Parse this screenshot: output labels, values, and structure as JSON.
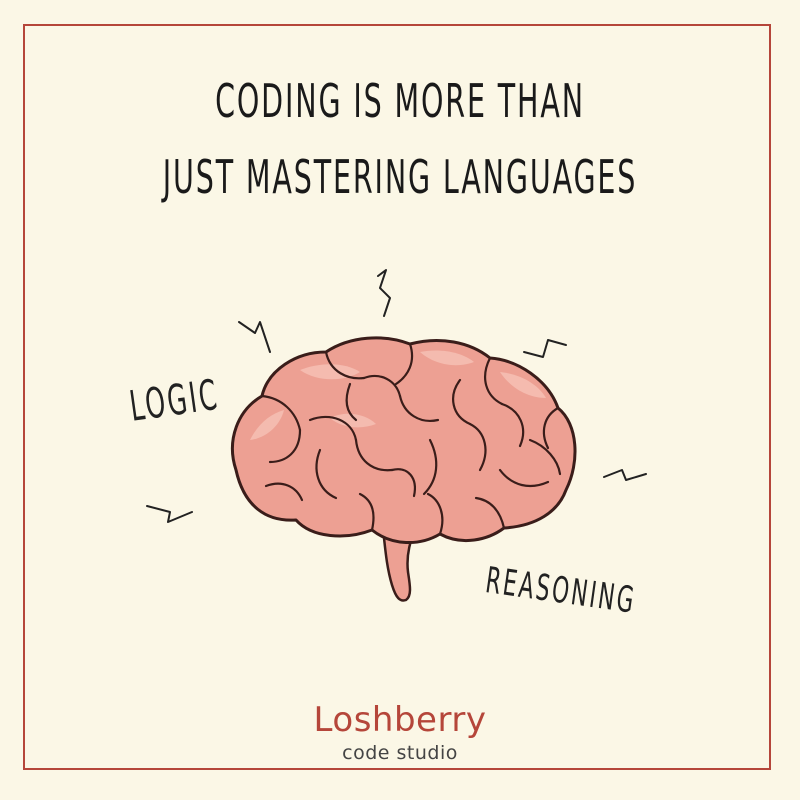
{
  "headline": {
    "line1": "CODING IS MORE THAN",
    "line2": "JUST MASTERING LANGUAGES"
  },
  "words": {
    "left": "LOGIC",
    "right": "REASONING"
  },
  "brand": {
    "name": "Loshberry",
    "tagline": "code studio"
  },
  "colors": {
    "background": "#fbf7e6",
    "frame": "#b5463a",
    "brain_fill": "#eda093",
    "brain_stroke": "#3a1d1a"
  },
  "illustration": {
    "icon": "brain-icon"
  }
}
